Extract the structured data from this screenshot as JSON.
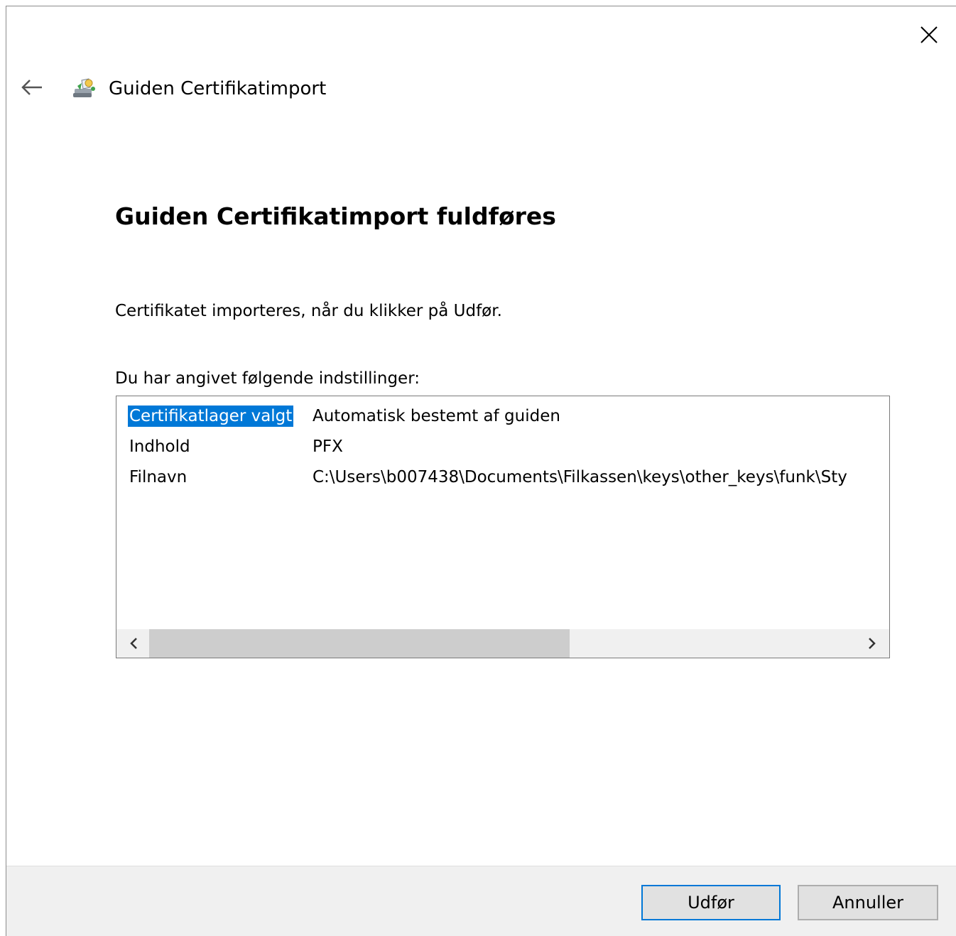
{
  "window": {
    "title": "Guiden Certifikatimport"
  },
  "page": {
    "heading": "Guiden Certifikatimport fuldføres",
    "description": "Certifikatet importeres, når du klikker på Udfør.",
    "settings_label": "Du har angivet følgende indstillinger:"
  },
  "settings": [
    {
      "key": "Certifikatlager valgt",
      "value": "Automatisk bestemt af guiden"
    },
    {
      "key": "Indhold",
      "value": "PFX"
    },
    {
      "key": "Filnavn",
      "value": "C:\\Users\\b007438\\Documents\\Filkassen\\keys\\other_keys\\funk\\Sty"
    }
  ],
  "buttons": {
    "finish": "Udfør",
    "cancel": "Annuller"
  },
  "colors": {
    "selection": "#0078d7",
    "primary_border": "#0078d7"
  },
  "icons": {
    "close": "close-icon",
    "back": "back-arrow-icon",
    "wizard": "certificate-wizard-icon"
  }
}
